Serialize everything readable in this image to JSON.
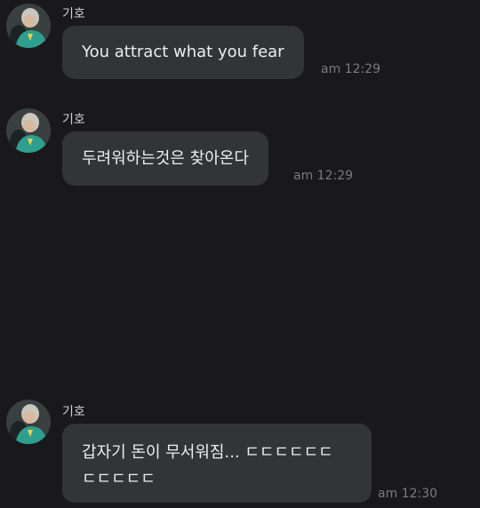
{
  "messages": [
    {
      "sender": "기호",
      "lines": [
        "You attract what you fear"
      ],
      "time": "am 12:29"
    },
    {
      "sender": "기호",
      "lines": [
        "두려워하는것은 찾아온다"
      ],
      "time": "am 12:29"
    },
    {
      "sender": "기호",
      "lines": [
        "갑자기 돈이 무서워짐... ㄷㄷㄷㄷㄷㄷ",
        "ㄷㄷㄷㄷㄷ"
      ],
      "time": "am 12:30"
    }
  ]
}
